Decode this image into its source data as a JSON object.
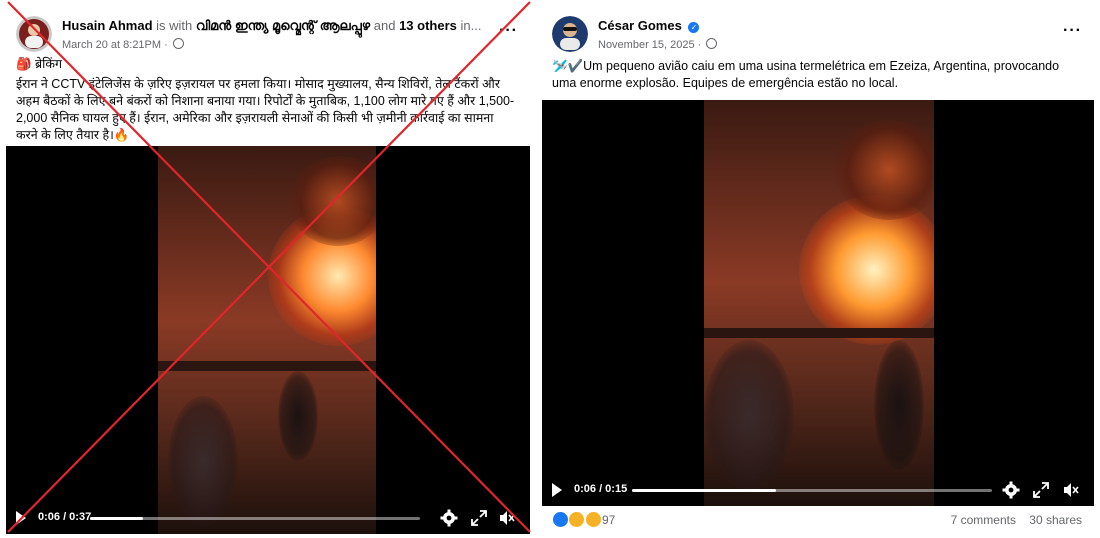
{
  "left_post": {
    "author": "Husain Ahmad",
    "with_text": "is with",
    "group": "വിമൻ ഇന്ത്യ മൂവ്മെന്റ് ആലപ്പുഴ",
    "and_text": "and",
    "others": "13 others",
    "ellipsis": "in...",
    "date": "March 20 at 8:21PM ·",
    "breaking": "🎒 ब्रेकिंग",
    "body": "ईरान ने CCTV इंटेलिजेंस के ज़रिए इज़रायल पर हमला किया। मोसाद मुख्यालय, सैन्य शिविरों, तेल टैंकरों और अहम बैठकों के लिए बने बंकरों को निशाना बनाया गया। रिपोर्टों के मुताबिक, 1,100 लोग मारे गए हैं और 1,500-2,000 सैनिक घायल हुए हैं। ईरान, अमेरिका और इज़रायली सेनाओं की किसी भी ज़मीनी कार्रवाई का सामना करने के लिए तैयार है।🔥",
    "video_time": "0:06 / 0:37",
    "video_progress": 0.162
  },
  "right_post": {
    "author": "César Gomes",
    "date": "November 15, 2025 ·",
    "body": "🛩️✔️Um pequeno avião caiu em uma usina termelétrica em Ezeiza, Argentina, provocando uma enorme explosão. Equipes de emergência estão no local.",
    "video_time": "0:06 / 0:15",
    "video_progress": 0.4,
    "reaction_count": "97",
    "comments": "7 comments",
    "shares": "30 shares"
  },
  "colors": {
    "verified_blue": "#1877f2",
    "cross_red": "#e0262b",
    "like_blue": "#1877f2",
    "wow_yellow": "#f7b125"
  },
  "icons": [
    "globe-icon",
    "more-options-icon",
    "play-icon",
    "settings-icon",
    "fullscreen-icon",
    "mute-icon",
    "verified-icon"
  ]
}
